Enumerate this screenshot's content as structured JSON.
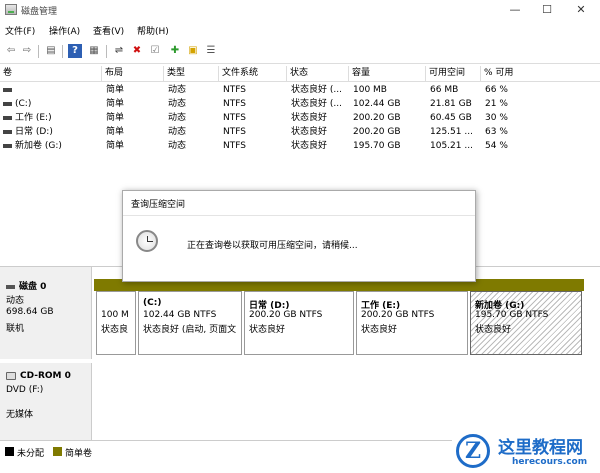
{
  "window": {
    "title": "磁盘管理",
    "min": "—",
    "max": "☐",
    "close": "✕"
  },
  "menu": [
    "文件(F)",
    "操作(A)",
    "查看(V)",
    "帮助(H)"
  ],
  "toolbar": {
    "back": "⇦",
    "forward": "⇨",
    "console": "▤",
    "help": "?",
    "properties": "▦",
    "connect": "⇌",
    "delete": "✖",
    "check": "☑",
    "add": "✚",
    "folder": "▣",
    "list": "☰"
  },
  "volumes": {
    "headers": [
      "卷",
      "布局",
      "类型",
      "文件系统",
      "状态",
      "容量",
      "可用空间",
      "% 可用"
    ],
    "rows": [
      {
        "name": "",
        "layout": "简单",
        "type": "动态",
        "fs": "NTFS",
        "status": "状态良好 (...",
        "capacity": "100 MB",
        "free": "66 MB",
        "pct": "66 %"
      },
      {
        "name": "(C:)",
        "layout": "简单",
        "type": "动态",
        "fs": "NTFS",
        "status": "状态良好 (...",
        "capacity": "102.44 GB",
        "free": "21.81 GB",
        "pct": "21 %"
      },
      {
        "name": "工作 (E:)",
        "layout": "简单",
        "type": "动态",
        "fs": "NTFS",
        "status": "状态良好",
        "capacity": "200.20 GB",
        "free": "60.45 GB",
        "pct": "30 %"
      },
      {
        "name": "日常 (D:)",
        "layout": "简单",
        "type": "动态",
        "fs": "NTFS",
        "status": "状态良好",
        "capacity": "200.20 GB",
        "free": "125.51 ...",
        "pct": "63 %"
      },
      {
        "name": "新加卷 (G:)",
        "layout": "简单",
        "type": "动态",
        "fs": "NTFS",
        "status": "状态良好",
        "capacity": "195.70 GB",
        "free": "105.21 ...",
        "pct": "54 %"
      }
    ]
  },
  "dialog": {
    "title": "查询压缩空间",
    "message": "正在查询卷以获取可用压缩空间，请稍候..."
  },
  "disk0": {
    "name": "磁盘 0",
    "type": "动态",
    "size": "698.64 GB",
    "state": "联机",
    "partitions": [
      {
        "name": "",
        "size": "100 M",
        "status": "状态良"
      },
      {
        "name": "(C:)",
        "size": "102.44 GB NTFS",
        "status": "状态良好 (启动, 页面文"
      },
      {
        "name": "日常 (D:)",
        "size": "200.20 GB NTFS",
        "status": "状态良好"
      },
      {
        "name": "工作 (E:)",
        "size": "200.20 GB NTFS",
        "status": "状态良好"
      },
      {
        "name": "新加卷 (G:)",
        "size": "195.70 GB NTFS",
        "status": "状态良好"
      }
    ]
  },
  "cdrom0": {
    "name": "CD-ROM 0",
    "drive": "DVD (F:)",
    "media": "无媒体"
  },
  "legend": {
    "unallocated": "未分配",
    "simple": "简单卷",
    "unallocated_color": "#000000",
    "simple_color": "#7f7a00"
  },
  "watermark": {
    "title": "这里教程网",
    "url": "herecours.com",
    "logo": "Z"
  }
}
